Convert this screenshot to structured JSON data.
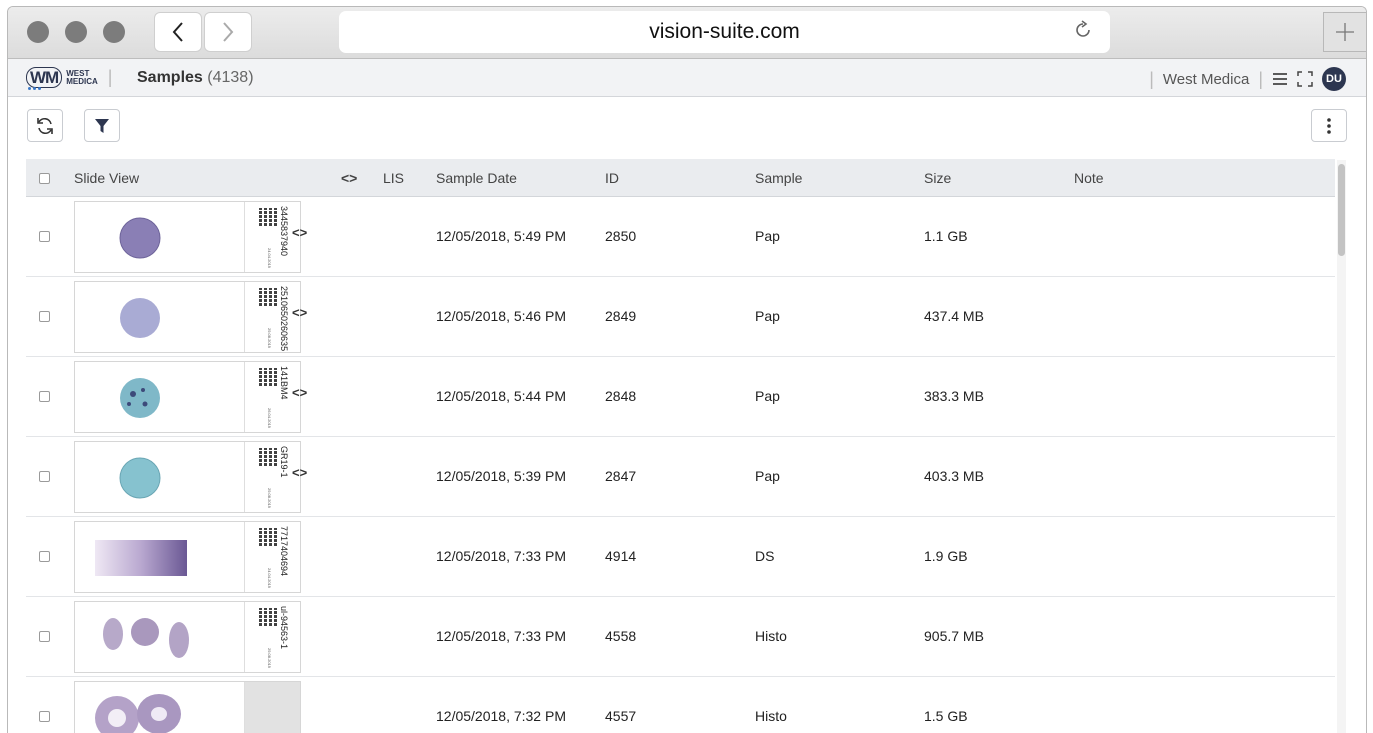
{
  "browser": {
    "url": "vision-suite.com",
    "back_icon": "chevron-left-icon",
    "forward_icon": "chevron-right-icon",
    "reload_icon": "reload-icon",
    "newtab_icon": "plus-icon"
  },
  "header": {
    "logo_initials": "WM",
    "logo_brand_line1": "WEST",
    "logo_brand_line2": "MEDICA",
    "title": "Samples",
    "count": "(4138)",
    "org": "West Medica",
    "avatar": "DU"
  },
  "toolbar": {
    "refresh_icon": "refresh-icon",
    "filter_icon": "filter-icon",
    "more_icon": "more-vertical-icon"
  },
  "table": {
    "columns": {
      "slide_view": "Slide View",
      "code": "<>",
      "lis": "LIS",
      "sample_date": "Sample Date",
      "id": "ID",
      "sample": "Sample",
      "size": "Size",
      "note": "Note"
    },
    "rows": [
      {
        "label_text": "3445837940",
        "label_date": "24.04.2019",
        "code": "<>",
        "date": "12/05/2018, 5:49 PM",
        "id": "2850",
        "sample": "Pap",
        "size": "1.1 GB",
        "note": ""
      },
      {
        "label_text": "2510650260635",
        "label_date": "29.08.2019",
        "code": "<>",
        "date": "12/05/2018, 5:46 PM",
        "id": "2849",
        "sample": "Pap",
        "size": "437.4 MB",
        "note": ""
      },
      {
        "label_text": "141BM4",
        "label_date": "26.04.2019",
        "code": "<>",
        "date": "12/05/2018, 5:44 PM",
        "id": "2848",
        "sample": "Pap",
        "size": "383.3 MB",
        "note": ""
      },
      {
        "label_text": "GR19-1",
        "label_date": "29.08.2019",
        "code": "<>",
        "date": "12/05/2018, 5:39 PM",
        "id": "2847",
        "sample": "Pap",
        "size": "403.3 MB",
        "note": ""
      },
      {
        "label_text": "7717404694",
        "label_date": "24.04.2019",
        "code": "",
        "date": "12/05/2018, 7:33 PM",
        "id": "4914",
        "sample": "DS",
        "size": "1.9 GB",
        "note": ""
      },
      {
        "label_text": "ul-94563-1",
        "label_date": "29.08.2019",
        "code": "",
        "date": "12/05/2018, 7:33 PM",
        "id": "4558",
        "sample": "Histo",
        "size": "905.7 MB",
        "note": ""
      },
      {
        "label_text": "",
        "label_date": "",
        "code": "",
        "date": "12/05/2018, 7:32 PM",
        "id": "4557",
        "sample": "Histo",
        "size": "1.5 GB",
        "note": ""
      }
    ]
  }
}
